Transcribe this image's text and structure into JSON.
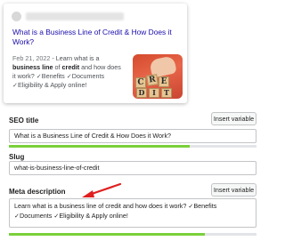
{
  "serp_preview": {
    "title": "What is a Business Line of Credit & How Does it Work?",
    "date": "Feb 21, 2022",
    "snippet_lead": "Learn what is a",
    "snippet_bold_1": "business line",
    "snippet_mid": "of",
    "snippet_bold_2": "credit",
    "snippet_tail": "and how does it work? ✓Benefits ✓Documents ✓Eligibility & Apply online!",
    "thumbnail_letters": [
      "C",
      "R",
      "E",
      "D",
      "I",
      "T"
    ]
  },
  "seo_title": {
    "label": "SEO title",
    "insert_label": "Insert variable",
    "value": "What is a Business Line of Credit & How Does it Work?",
    "progress": 0.73
  },
  "slug": {
    "label": "Slug",
    "value": "what-is-business-line-of-credit"
  },
  "meta_description": {
    "label": "Meta description",
    "insert_label": "Insert variable",
    "value": "Learn what is a business line of credit and how does it work? ✓Benefits ✓Documents ✓Eligibility & Apply online!",
    "progress": 0.79
  },
  "colors": {
    "serp_title": "#1a0dab",
    "progress_good": "#7ad03a",
    "annotation_arrow": "#e02020"
  }
}
